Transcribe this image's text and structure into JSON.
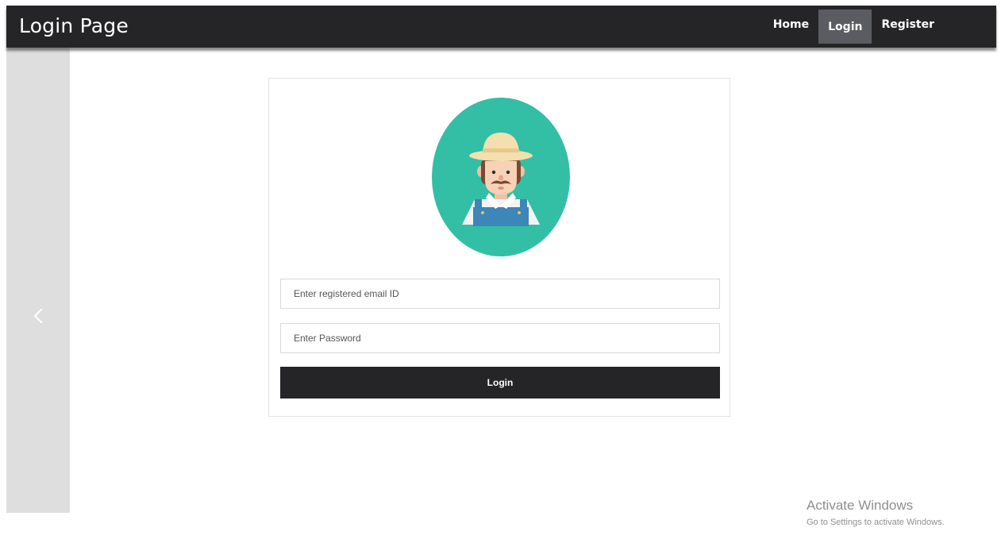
{
  "navbar": {
    "brand": "Login Page",
    "links": [
      "Home",
      "Login",
      "Register"
    ],
    "active_link": "Login",
    "background_color": "#252528"
  },
  "carousel": {
    "prev_icon": "chevron-left-icon"
  },
  "login_form": {
    "avatar_icon": "farmer-avatar-icon",
    "avatar_bg_color": "#33bfa5",
    "email_placeholder": "Enter registered email ID",
    "password_placeholder": "Enter Password",
    "login_label": "Login"
  },
  "watermark": {
    "title": "Activate Windows",
    "subtitle": "Go to Settings to activate Windows."
  }
}
